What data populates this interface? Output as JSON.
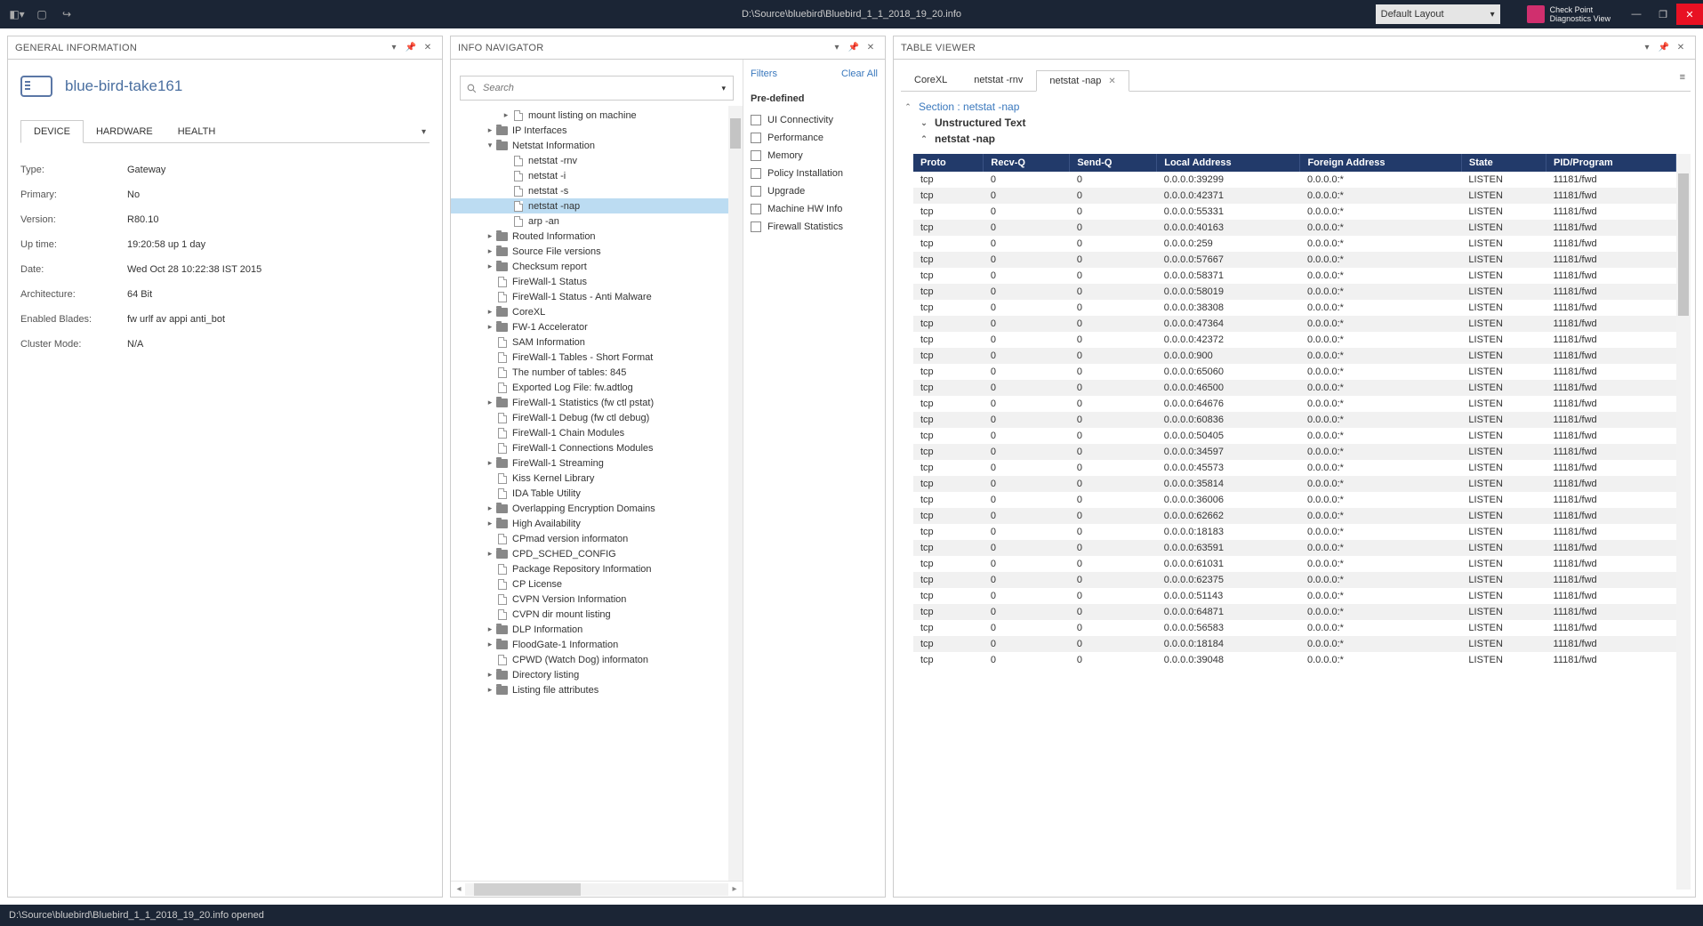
{
  "title_path": "D:\\Source\\bluebird\\Bluebird_1_1_2018_19_20.info",
  "layout_selector": "Default Layout",
  "brand": {
    "line1": "Check Point",
    "line2": "Diagnostics View"
  },
  "status_text": "D:\\Source\\bluebird\\Bluebird_1_1_2018_19_20.info opened",
  "gi": {
    "panel_title": "GENERAL INFORMATION",
    "device_name": "blue-bird-take161",
    "tabs": [
      "DEVICE",
      "HARDWARE",
      "HEALTH"
    ],
    "rows": [
      {
        "k": "Type:",
        "v": "Gateway"
      },
      {
        "k": "Primary:",
        "v": "No"
      },
      {
        "k": "Version:",
        "v": "R80.10"
      },
      {
        "k": "Up time:",
        "v": "19:20:58 up 1 day"
      },
      {
        "k": "Date:",
        "v": "Wed Oct 28 10:22:38 IST 2015"
      },
      {
        "k": "Architecture:",
        "v": "64 Bit"
      },
      {
        "k": "Enabled Blades:",
        "v": "fw urlf av appi anti_bot"
      },
      {
        "k": "Cluster Mode:",
        "v": "N/A"
      }
    ]
  },
  "nav": {
    "panel_title": "INFO NAVIGATOR",
    "search_placeholder": "Search",
    "filters_label": "Filters",
    "clear_all": "Clear All",
    "predefined_label": "Pre-defined",
    "filters": [
      "UI Connectivity",
      "Performance",
      "Memory",
      "Policy Installation",
      "Upgrade",
      "Machine HW Info",
      "Firewall Statistics"
    ],
    "tree": [
      {
        "d": 2,
        "t": "file",
        "tw": "▸",
        "label": "mount listing on machine"
      },
      {
        "d": 1,
        "t": "folder",
        "tw": "▸",
        "label": "IP Interfaces"
      },
      {
        "d": 1,
        "t": "folder",
        "tw": "▾",
        "label": "Netstat Information"
      },
      {
        "d": 2,
        "t": "file",
        "tw": "",
        "label": "netstat -rnv"
      },
      {
        "d": 2,
        "t": "file",
        "tw": "",
        "label": "netstat -i"
      },
      {
        "d": 2,
        "t": "file",
        "tw": "",
        "label": "netstat -s"
      },
      {
        "d": 2,
        "t": "file",
        "tw": "",
        "label": "netstat -nap",
        "sel": true
      },
      {
        "d": 2,
        "t": "file",
        "tw": "",
        "label": "arp -an"
      },
      {
        "d": 1,
        "t": "folder",
        "tw": "▸",
        "label": "Routed Information"
      },
      {
        "d": 1,
        "t": "folder",
        "tw": "▸",
        "label": "Source File versions"
      },
      {
        "d": 1,
        "t": "folder",
        "tw": "▸",
        "label": "Checksum report"
      },
      {
        "d": 1,
        "t": "file",
        "tw": "",
        "label": "FireWall-1 Status"
      },
      {
        "d": 1,
        "t": "file",
        "tw": "",
        "label": "FireWall-1 Status - Anti Malware"
      },
      {
        "d": 1,
        "t": "folder",
        "tw": "▸",
        "label": "CoreXL"
      },
      {
        "d": 1,
        "t": "folder",
        "tw": "▸",
        "label": "FW-1 Accelerator"
      },
      {
        "d": 1,
        "t": "file",
        "tw": "",
        "label": "SAM Information"
      },
      {
        "d": 1,
        "t": "file",
        "tw": "",
        "label": "FireWall-1 Tables - Short Format"
      },
      {
        "d": 1,
        "t": "file",
        "tw": "",
        "label": "The number of tables: 845"
      },
      {
        "d": 1,
        "t": "file",
        "tw": "",
        "label": "Exported Log File: fw.adtlog"
      },
      {
        "d": 1,
        "t": "folder",
        "tw": "▸",
        "label": "FireWall-1 Statistics (fw ctl pstat)"
      },
      {
        "d": 1,
        "t": "file",
        "tw": "",
        "label": "FireWall-1 Debug (fw ctl debug)"
      },
      {
        "d": 1,
        "t": "file",
        "tw": "",
        "label": "FireWall-1 Chain Modules"
      },
      {
        "d": 1,
        "t": "file",
        "tw": "",
        "label": "FireWall-1 Connections Modules"
      },
      {
        "d": 1,
        "t": "folder",
        "tw": "▸",
        "label": "FireWall-1 Streaming"
      },
      {
        "d": 1,
        "t": "file",
        "tw": "",
        "label": "Kiss Kernel Library"
      },
      {
        "d": 1,
        "t": "file",
        "tw": "",
        "label": "IDA Table Utility"
      },
      {
        "d": 1,
        "t": "folder",
        "tw": "▸",
        "label": "Overlapping Encryption Domains"
      },
      {
        "d": 1,
        "t": "folder",
        "tw": "▸",
        "label": "High Availability"
      },
      {
        "d": 1,
        "t": "file",
        "tw": "",
        "label": "CPmad version informaton"
      },
      {
        "d": 1,
        "t": "folder",
        "tw": "▸",
        "label": "CPD_SCHED_CONFIG"
      },
      {
        "d": 1,
        "t": "file",
        "tw": "",
        "label": "Package Repository Information"
      },
      {
        "d": 1,
        "t": "file",
        "tw": "",
        "label": "CP License"
      },
      {
        "d": 1,
        "t": "file",
        "tw": "",
        "label": "CVPN Version Information"
      },
      {
        "d": 1,
        "t": "file",
        "tw": "",
        "label": "CVPN dir mount listing"
      },
      {
        "d": 1,
        "t": "folder",
        "tw": "▸",
        "label": "DLP Information"
      },
      {
        "d": 1,
        "t": "folder",
        "tw": "▸",
        "label": "FloodGate-1 Information"
      },
      {
        "d": 1,
        "t": "file",
        "tw": "",
        "label": "CPWD (Watch Dog) informaton"
      },
      {
        "d": 1,
        "t": "folder",
        "tw": "▸",
        "label": "Directory listing"
      },
      {
        "d": 1,
        "t": "folder",
        "tw": "▸",
        "label": "Listing file attributes"
      }
    ]
  },
  "tv": {
    "panel_title": "TABLE VIEWER",
    "tabs": [
      {
        "label": "CoreXL",
        "active": false,
        "close": false
      },
      {
        "label": "netstat -rnv",
        "active": false,
        "close": false
      },
      {
        "label": "netstat -nap",
        "active": true,
        "close": true
      }
    ],
    "section_title": "Section : netstat -nap",
    "section_sub1": "Unstructured Text",
    "section_sub2": "netstat -nap",
    "columns": [
      "Proto",
      "Recv-Q",
      "Send-Q",
      "Local Address",
      "Foreign Address",
      "State",
      "PID/Program"
    ],
    "rows": [
      [
        "tcp",
        "0",
        "0",
        "0.0.0.0:39299",
        "0.0.0.0:*",
        "LISTEN",
        "11181/fwd"
      ],
      [
        "tcp",
        "0",
        "0",
        "0.0.0.0:42371",
        "0.0.0.0:*",
        "LISTEN",
        "11181/fwd"
      ],
      [
        "tcp",
        "0",
        "0",
        "0.0.0.0:55331",
        "0.0.0.0:*",
        "LISTEN",
        "11181/fwd"
      ],
      [
        "tcp",
        "0",
        "0",
        "0.0.0.0:40163",
        "0.0.0.0:*",
        "LISTEN",
        "11181/fwd"
      ],
      [
        "tcp",
        "0",
        "0",
        "0.0.0.0:259",
        "0.0.0.0:*",
        "LISTEN",
        "11181/fwd"
      ],
      [
        "tcp",
        "0",
        "0",
        "0.0.0.0:57667",
        "0.0.0.0:*",
        "LISTEN",
        "11181/fwd"
      ],
      [
        "tcp",
        "0",
        "0",
        "0.0.0.0:58371",
        "0.0.0.0:*",
        "LISTEN",
        "11181/fwd"
      ],
      [
        "tcp",
        "0",
        "0",
        "0.0.0.0:58019",
        "0.0.0.0:*",
        "LISTEN",
        "11181/fwd"
      ],
      [
        "tcp",
        "0",
        "0",
        "0.0.0.0:38308",
        "0.0.0.0:*",
        "LISTEN",
        "11181/fwd"
      ],
      [
        "tcp",
        "0",
        "0",
        "0.0.0.0:47364",
        "0.0.0.0:*",
        "LISTEN",
        "11181/fwd"
      ],
      [
        "tcp",
        "0",
        "0",
        "0.0.0.0:42372",
        "0.0.0.0:*",
        "LISTEN",
        "11181/fwd"
      ],
      [
        "tcp",
        "0",
        "0",
        "0.0.0.0:900",
        "0.0.0.0:*",
        "LISTEN",
        "11181/fwd"
      ],
      [
        "tcp",
        "0",
        "0",
        "0.0.0.0:65060",
        "0.0.0.0:*",
        "LISTEN",
        "11181/fwd"
      ],
      [
        "tcp",
        "0",
        "0",
        "0.0.0.0:46500",
        "0.0.0.0:*",
        "LISTEN",
        "11181/fwd"
      ],
      [
        "tcp",
        "0",
        "0",
        "0.0.0.0:64676",
        "0.0.0.0:*",
        "LISTEN",
        "11181/fwd"
      ],
      [
        "tcp",
        "0",
        "0",
        "0.0.0.0:60836",
        "0.0.0.0:*",
        "LISTEN",
        "11181/fwd"
      ],
      [
        "tcp",
        "0",
        "0",
        "0.0.0.0:50405",
        "0.0.0.0:*",
        "LISTEN",
        "11181/fwd"
      ],
      [
        "tcp",
        "0",
        "0",
        "0.0.0.0:34597",
        "0.0.0.0:*",
        "LISTEN",
        "11181/fwd"
      ],
      [
        "tcp",
        "0",
        "0",
        "0.0.0.0:45573",
        "0.0.0.0:*",
        "LISTEN",
        "11181/fwd"
      ],
      [
        "tcp",
        "0",
        "0",
        "0.0.0.0:35814",
        "0.0.0.0:*",
        "LISTEN",
        "11181/fwd"
      ],
      [
        "tcp",
        "0",
        "0",
        "0.0.0.0:36006",
        "0.0.0.0:*",
        "LISTEN",
        "11181/fwd"
      ],
      [
        "tcp",
        "0",
        "0",
        "0.0.0.0:62662",
        "0.0.0.0:*",
        "LISTEN",
        "11181/fwd"
      ],
      [
        "tcp",
        "0",
        "0",
        "0.0.0.0:18183",
        "0.0.0.0:*",
        "LISTEN",
        "11181/fwd"
      ],
      [
        "tcp",
        "0",
        "0",
        "0.0.0.0:63591",
        "0.0.0.0:*",
        "LISTEN",
        "11181/fwd"
      ],
      [
        "tcp",
        "0",
        "0",
        "0.0.0.0:61031",
        "0.0.0.0:*",
        "LISTEN",
        "11181/fwd"
      ],
      [
        "tcp",
        "0",
        "0",
        "0.0.0.0:62375",
        "0.0.0.0:*",
        "LISTEN",
        "11181/fwd"
      ],
      [
        "tcp",
        "0",
        "0",
        "0.0.0.0:51143",
        "0.0.0.0:*",
        "LISTEN",
        "11181/fwd"
      ],
      [
        "tcp",
        "0",
        "0",
        "0.0.0.0:64871",
        "0.0.0.0:*",
        "LISTEN",
        "11181/fwd"
      ],
      [
        "tcp",
        "0",
        "0",
        "0.0.0.0:56583",
        "0.0.0.0:*",
        "LISTEN",
        "11181/fwd"
      ],
      [
        "tcp",
        "0",
        "0",
        "0.0.0.0:18184",
        "0.0.0.0:*",
        "LISTEN",
        "11181/fwd"
      ],
      [
        "tcp",
        "0",
        "0",
        "0.0.0.0:39048",
        "0.0.0.0:*",
        "LISTEN",
        "11181/fwd"
      ]
    ]
  }
}
